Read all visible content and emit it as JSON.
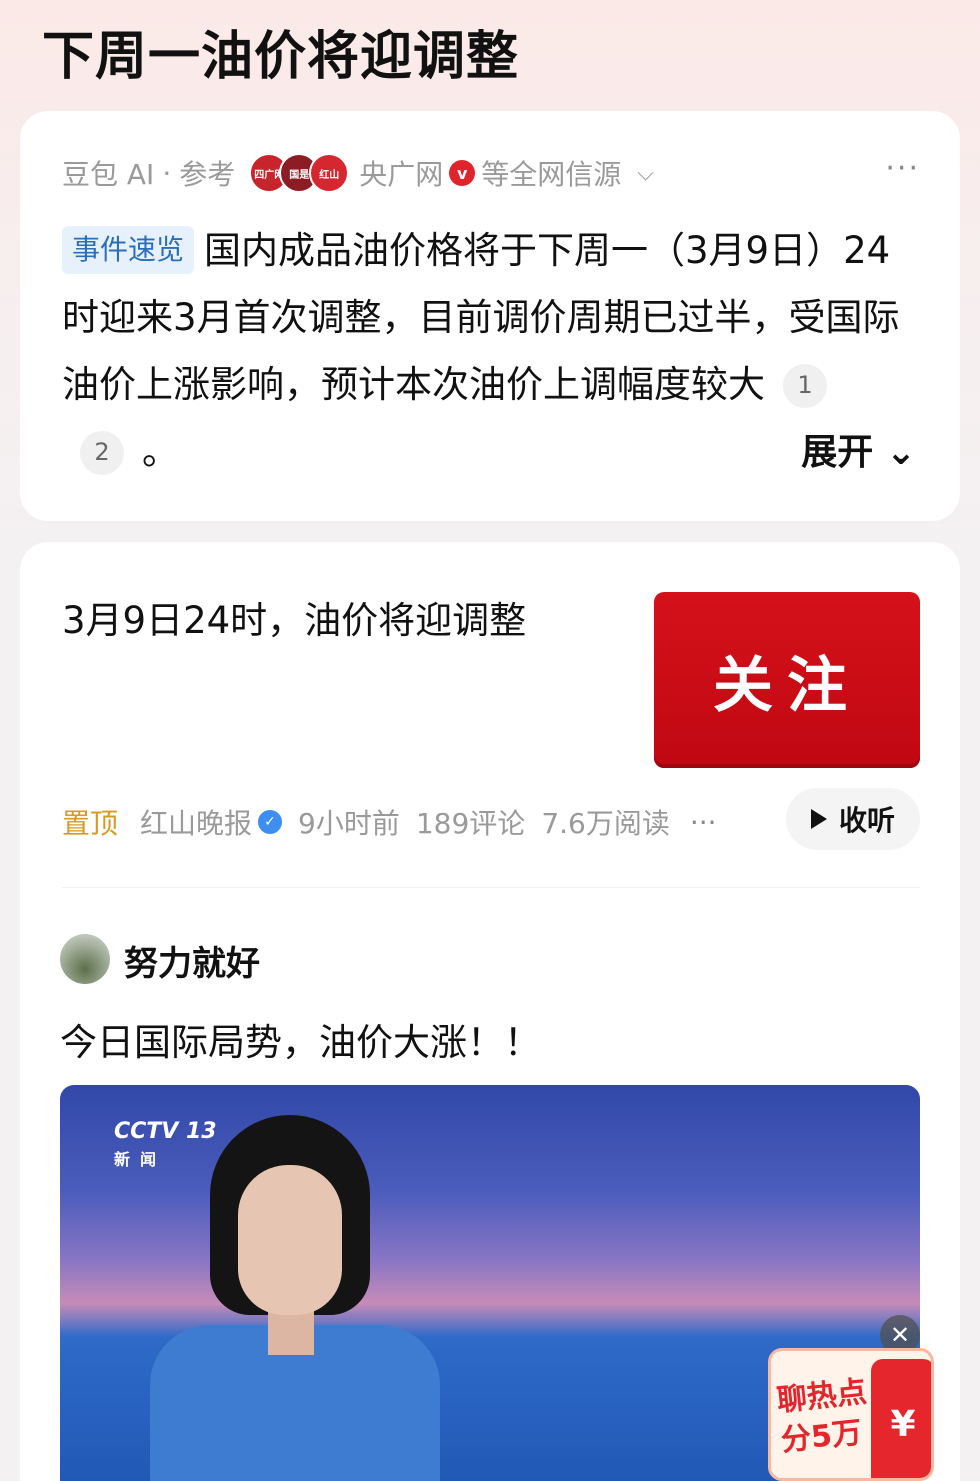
{
  "page": {
    "title": "下周一油价将迎调整"
  },
  "ai_summary": {
    "source_label": "豆包 AI",
    "separator": "·",
    "reference_label": "参考",
    "source_logos": [
      "四广网",
      "国是",
      "红山"
    ],
    "source_name": "央广网",
    "verified_mark": "v",
    "source_suffix": "等全网信源",
    "tag": "事件速览",
    "text_part1": "国内成品油价格将于下周一（3月9日）24时迎来3月首次调整，目前调价周期已过半，受国际油价上涨影响，预计本次油价上调幅度较大",
    "citations": [
      "1",
      "2"
    ],
    "text_end": "。",
    "expand_label": "展开",
    "more_label": "···"
  },
  "article": {
    "title": "3月9日24时，油价将迎调整",
    "thumbnail_text": "关注",
    "pinned_label": "置顶",
    "publisher": "红山晚报",
    "time": "9小时前",
    "comments": "189评论",
    "reads": "7.6万阅读",
    "more_label": "···",
    "listen_label": "收听"
  },
  "post": {
    "author": "努力就好",
    "text": "今日国际局势，油价大涨！！",
    "video": {
      "channel_logo": "CCTV 13",
      "channel_sub": "新闻"
    }
  },
  "promo": {
    "line1": "聊热点",
    "line2": "分5万",
    "coin": "¥",
    "close": "✕"
  },
  "icons": {
    "verified_red": "verified-badge-red",
    "verified_blue": "verified-badge-blue",
    "chevron": "chevron-down-icon",
    "play": "play-icon"
  }
}
